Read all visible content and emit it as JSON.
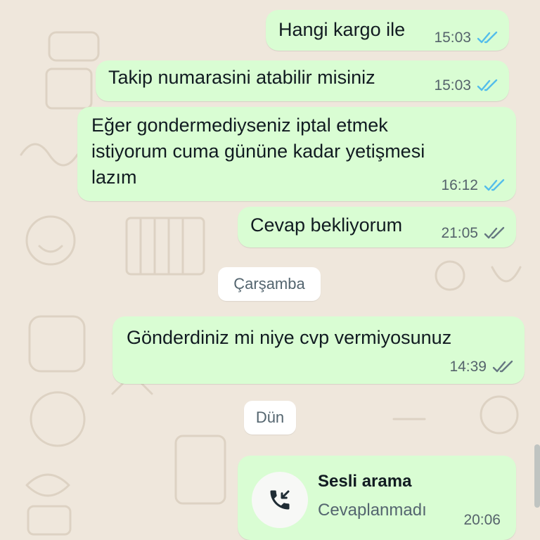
{
  "messages": [
    {
      "text": "Hangi kargo ile",
      "time": "15:03",
      "status": "read"
    },
    {
      "text": "Takip numarasini atabilir misiniz",
      "time": "15:03",
      "status": "read"
    },
    {
      "lines": [
        "Eğer gondermediyseniz iptal etmek",
        "istiyorum cuma gününe kadar yetişmesi",
        "lazım"
      ],
      "time": "16:12",
      "status": "read"
    },
    {
      "text": "Cevap bekliyorum",
      "time": "21:05",
      "status": "delivered"
    },
    {
      "text": "Gönderdiniz mi niye cvp vermiyosunuz",
      "time": "14:39",
      "status": "delivered"
    }
  ],
  "date_chips": {
    "wednesday": "Çarşamba",
    "yesterday": "Dün"
  },
  "call": {
    "title": "Sesli arama",
    "subtitle": "Cevaplanmadı",
    "time": "20:06",
    "icon": "missed-call-icon"
  },
  "colors": {
    "wallpaper": "#efe7dc",
    "outgoing_bubble": "#d9fdd3",
    "read_ticks": "#53bdeb",
    "delivered_ticks": "#667781",
    "date_chip": "#ffffff"
  }
}
